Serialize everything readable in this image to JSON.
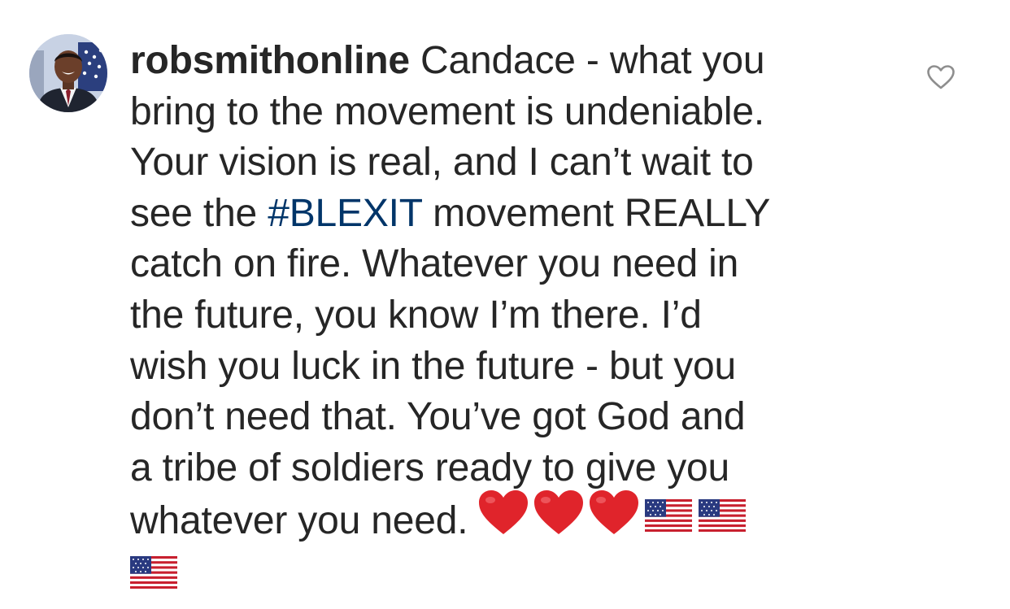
{
  "comment": {
    "username": "robsmithonline",
    "text_lines": [
      "Candace - what you",
      "bring to the movement is undeniable.",
      "Your vision is real, and I can’t wait to",
      "see the ",
      "#BLEXIT",
      " movement REALLY",
      "catch on fire. Whatever you need in",
      "the future, you know I’m there. I’d",
      "wish you luck in the future - but you",
      "don’t need that. You’ve got God and",
      "a tribe of soldiers ready to give you",
      "whatever you need."
    ],
    "emojis": [
      "red-heart",
      "red-heart",
      "red-heart",
      "us-flag",
      "us-flag",
      "us-flag"
    ]
  },
  "colors": {
    "text": "#262626",
    "hashtag": "#003569",
    "heart_red": "#e0242b",
    "like_outline": "#8e8e8e"
  },
  "icons": {
    "like": "heart-outline-icon"
  }
}
